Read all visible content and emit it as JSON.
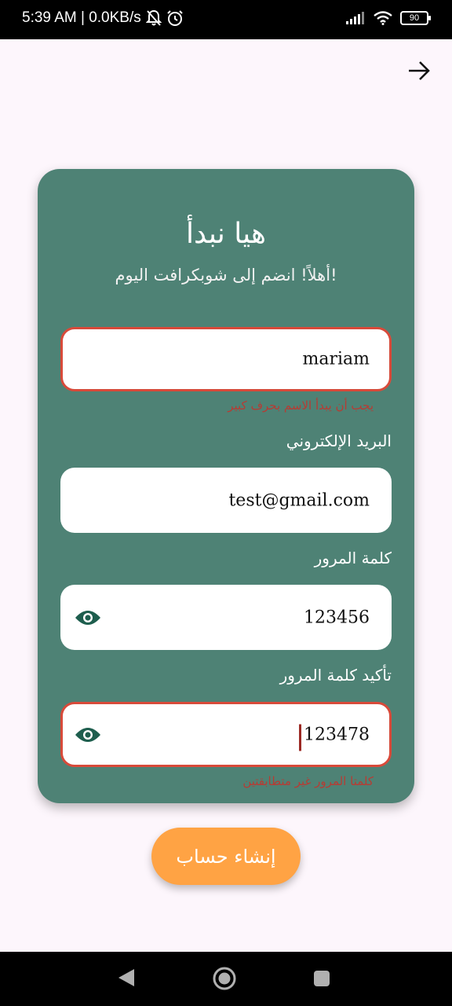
{
  "status_bar": {
    "time_speed": "5:39 AM | 0.0KB/s",
    "battery_level": "90"
  },
  "header": {
    "title": "هيا نبدأ",
    "subtitle": "أهلاً! انضم إلى شوبكرافت اليوم!"
  },
  "form": {
    "name": {
      "value": "mariam",
      "error": "يجب أن يبدأ الاسم بحرف كبير"
    },
    "email": {
      "label": "البريد الإلكتروني",
      "value": "test@gmail.com"
    },
    "password": {
      "label": "كلمة المرور",
      "value": "123456"
    },
    "confirm_password": {
      "label": "تأكيد كلمة المرور",
      "value": "123478",
      "error": "كلمتا المرور غير متطابقتين"
    }
  },
  "actions": {
    "create_account": "إنشاء حساب"
  },
  "colors": {
    "card": "#4e8275",
    "button": "#ffa344",
    "error": "#d84a3a",
    "eye_icon": "#1e5e4e"
  }
}
